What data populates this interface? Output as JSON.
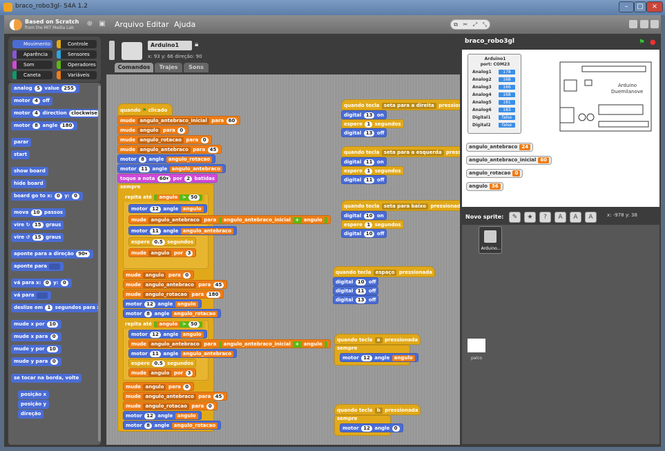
{
  "window": {
    "title": "braco_robo3gl- S4A 1.2"
  },
  "app": {
    "logo_line1": "Based on Scratch",
    "logo_line2": "from the MIT Media Lab",
    "menus": [
      "Arquivo",
      "Editar",
      "Ajuda"
    ]
  },
  "categories": [
    {
      "label": "Movimento",
      "color": "#4a6cd4"
    },
    {
      "label": "Controle",
      "color": "#e1a91a"
    },
    {
      "label": "Aparência",
      "color": "#8a55d7"
    },
    {
      "label": "Sensores",
      "color": "#2ca5e2"
    },
    {
      "label": "Som",
      "color": "#cf4ad9"
    },
    {
      "label": "Operadores",
      "color": "#5cb712"
    },
    {
      "label": "Caneta",
      "color": "#0e9a6c"
    },
    {
      "label": "Variáveis",
      "color": "#ee7d16"
    }
  ],
  "palette": {
    "analog_label": "analog",
    "analog_pin": "5",
    "analog_value_label": "value",
    "analog_value": "255",
    "motor_off_label": "motor",
    "motor_off_pin": "4",
    "motor_off_text": "off",
    "motor_dir_label": "motor",
    "motor_dir_pin": "4",
    "motor_dir_text": "direction",
    "motor_dir_value": "clockwise",
    "motor_angle_label": "motor",
    "motor_angle_pin": "8",
    "motor_angle_text": "angle",
    "motor_angle_value": "180",
    "stop": "parar",
    "start": "start",
    "show_board": "show board",
    "hide_board": "hide board",
    "board_go_label": "board go to x:",
    "board_go_x": "0",
    "board_go_y_label": "y:",
    "board_go_y": "0",
    "move_label": "mova",
    "move_steps": "10",
    "move_unit": "passos",
    "turn_r_label": "vire ↻",
    "turn_r_deg": "15",
    "turn_r_unit": "graus",
    "turn_l_label": "vire ↺",
    "turn_l_deg": "15",
    "turn_l_unit": "graus",
    "point_dir_label": "aponte para a direção",
    "point_dir_value": "90▾",
    "point_to_label": "aponte para",
    "goto_xy_label": "vá para x:",
    "goto_xy_x": "0",
    "goto_xy_y_label": "y:",
    "goto_xy_y": "0",
    "goto_label": "vá para",
    "glide_label": "deslize em",
    "glide_secs": "1",
    "glide_text": "segundos para x:",
    "change_x_label": "mude x por",
    "change_x_val": "10",
    "set_x_label": "mude x para",
    "set_x_val": "0",
    "change_y_label": "mude y por",
    "change_y_val": "10",
    "set_y_label": "mude y para",
    "set_y_val": "0",
    "bounce": "se tocar na borda, volte",
    "rep_x": "posição x",
    "rep_y": "posição y",
    "rep_dir": "direção"
  },
  "sprite": {
    "name": "Arduino1",
    "x": "93",
    "y": "66",
    "direction": "90",
    "pos_text": "x: 93   y: 66   direção: 90",
    "tabs": [
      "Comandos",
      "Trajes",
      "Sons"
    ]
  },
  "script_main": {
    "when_label": "quando",
    "when_clicked": "clicado",
    "set1": {
      "verb": "mude",
      "var": "angulo_antebraco_inicial",
      "to": "para",
      "val": "60"
    },
    "set2": {
      "verb": "mude",
      "var": "angulo",
      "to": "para",
      "val": "0"
    },
    "set3": {
      "verb": "mude",
      "var": "angulo_rotacao",
      "to": "para",
      "val": "0"
    },
    "set4": {
      "verb": "mude",
      "var": "angulo_antebraco",
      "to": "para",
      "val": "45"
    },
    "motor1": {
      "label": "motor",
      "pin": "8",
      "text": "angle",
      "var": "angulo_rotacao"
    },
    "motor2": {
      "label": "motor",
      "pin": "11",
      "text": "angle",
      "var": "angulo_antebraco"
    },
    "note": {
      "label": "toque a nota",
      "note": "60▾",
      "per": "por",
      "beats": "2",
      "unit": "batidas"
    },
    "forever": "sempre",
    "rep1": {
      "label": "repita até",
      "var": "angulo",
      "op": ">",
      "val": "50"
    },
    "r1m1": {
      "label": "motor",
      "pin": "12",
      "text": "angle",
      "var": "angulo"
    },
    "r1set": {
      "verb": "mude",
      "var": "angulo_antebraco",
      "to": "para",
      "v1": "angulo_antebraco_inicial",
      "op": "+",
      "v2": "angulo"
    },
    "r1m2": {
      "label": "motor",
      "pin": "11",
      "text": "angle",
      "var": "angulo_antebraco"
    },
    "r1wait": {
      "label": "espere",
      "val": "0.5",
      "unit": "segundos"
    },
    "r1chg": {
      "verb": "mude",
      "var": "angulo",
      "by": "por",
      "val": "3"
    },
    "mid1": {
      "verb": "mude",
      "var": "angulo",
      "to": "para",
      "val": "0"
    },
    "mid2": {
      "verb": "mude",
      "var": "angulo_antebraco",
      "to": "para",
      "val": "45"
    },
    "mid3": {
      "verb": "mude",
      "var": "angulo_rotacao",
      "to": "para",
      "val": "180"
    },
    "midm1": {
      "label": "motor",
      "pin": "12",
      "text": "angle",
      "var": "angulo"
    },
    "midm2": {
      "label": "motor",
      "pin": "8",
      "text": "angle",
      "var": "angulo_rotacao"
    },
    "rep2": {
      "label": "repita até",
      "var": "angulo",
      "op": ">",
      "val": "50"
    },
    "r2m1": {
      "label": "motor",
      "pin": "12",
      "text": "angle",
      "var": "angulo"
    },
    "r2set": {
      "verb": "mude",
      "var": "angulo_antebraco",
      "to": "para",
      "v1": "angulo_antebraco_inicial",
      "op": "+",
      "v2": "angulo"
    },
    "r2m2": {
      "label": "motor",
      "pin": "11",
      "text": "angle",
      "var": "angulo_antebraco"
    },
    "r2wait": {
      "label": "espere",
      "val": "0.5",
      "unit": "segundos"
    },
    "r2chg": {
      "verb": "mude",
      "var": "angulo",
      "by": "por",
      "val": "3"
    },
    "end1": {
      "verb": "mude",
      "var": "angulo",
      "to": "para",
      "val": "0"
    },
    "end2": {
      "verb": "mude",
      "var": "angulo_antebraco",
      "to": "para",
      "val": "45"
    },
    "end3": {
      "verb": "mude",
      "var": "angulo_rotacao",
      "to": "para",
      "val": "0"
    },
    "endm1": {
      "label": "motor",
      "pin": "12",
      "text": "angle",
      "var": "angulo"
    },
    "endm2": {
      "label": "motor",
      "pin": "8",
      "text": "angle",
      "var": "angulo_rotacao"
    }
  },
  "scripts_side": [
    {
      "key": "seta para a direita",
      "lines": [
        [
          "digital",
          "13",
          "on"
        ],
        [
          "espere",
          "1",
          "segundos"
        ],
        [
          "digital",
          "13",
          "off"
        ]
      ]
    },
    {
      "key": "seta para a esquerda",
      "lines": [
        [
          "digital",
          "11",
          "on"
        ],
        [
          "espere",
          "1",
          "segundos"
        ],
        [
          "digital",
          "11",
          "off"
        ]
      ]
    },
    {
      "key": "seta para baixo",
      "lines": [
        [
          "digital",
          "10",
          "on"
        ],
        [
          "espere",
          "1",
          "segundos"
        ],
        [
          "digital",
          "10",
          "off"
        ]
      ]
    },
    {
      "key": "espaço",
      "lines": [
        [
          "digital",
          "10",
          "off"
        ],
        [
          "digital",
          "11",
          "off"
        ],
        [
          "digital",
          "13",
          "off"
        ]
      ]
    },
    {
      "key": "a",
      "forever": "sempre",
      "motor": [
        "motor",
        "12",
        "angle",
        "angulo"
      ]
    },
    {
      "key": "b",
      "forever": "sempre",
      "motor": [
        "motor",
        "12",
        "angle",
        "0"
      ]
    }
  ],
  "hat_label": "quando tecla",
  "hat_suffix": "pressionada",
  "stage": {
    "title": "braco_robo3gl",
    "sensor_title1": "Arduino1",
    "sensor_title2": "port: COM23",
    "sensors": [
      {
        "name": "Analog1",
        "value": "178"
      },
      {
        "name": "Analog2",
        "value": "168"
      },
      {
        "name": "Analog3",
        "value": "166"
      },
      {
        "name": "Analog4",
        "value": "168"
      },
      {
        "name": "Analog5",
        "value": "181"
      },
      {
        "name": "Analog6",
        "value": "183"
      },
      {
        "name": "Digital1",
        "value": "false"
      },
      {
        "name": "Digital2",
        "value": "false"
      }
    ],
    "board_text1": "Arduino",
    "board_text2": "Duemilanove",
    "monitors": [
      {
        "name": "angulo_antebraco",
        "value": "24"
      },
      {
        "name": "angulo_antebraco_inicial",
        "value": "60"
      },
      {
        "name": "angulo_rotacao",
        "value": "0"
      },
      {
        "name": "angulo",
        "value": "36"
      }
    ]
  },
  "sprites": {
    "new_label": "Novo sprite:",
    "coords": "x: -978   y: 38",
    "items": [
      {
        "name": "Arduino..."
      }
    ],
    "stage_label": "palco"
  }
}
